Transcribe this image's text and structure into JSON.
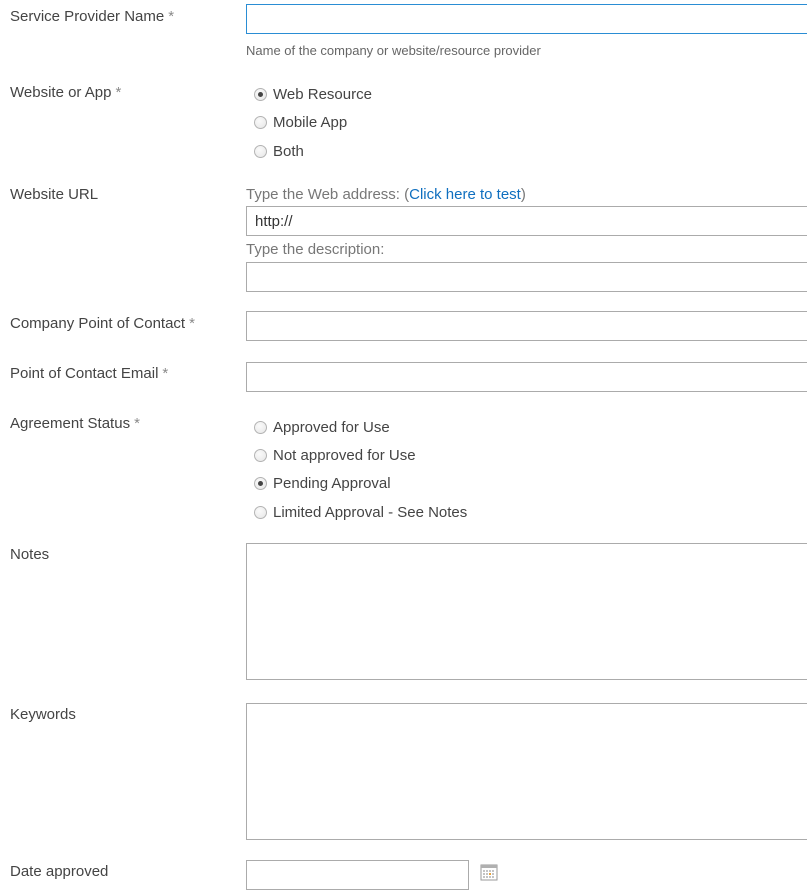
{
  "form": {
    "service_provider": {
      "label": "Service Provider Name",
      "required_mark": "*",
      "value": "",
      "hint": "Name of the company or website/resource provider"
    },
    "website_or_app": {
      "label": "Website or App",
      "required_mark": "*",
      "options": [
        "Web Resource",
        "Mobile App",
        "Both"
      ],
      "selected": "Web Resource"
    },
    "website_url": {
      "label": "Website URL",
      "address_prompt": "Type the Web address: (",
      "test_link": "Click here to test",
      "address_prompt_end": ")",
      "address_value": "http://",
      "description_prompt": "Type the description:",
      "description_value": ""
    },
    "company_contact": {
      "label": "Company Point of Contact",
      "required_mark": "*",
      "value": ""
    },
    "contact_email": {
      "label": "Point of Contact Email",
      "required_mark": "*",
      "value": ""
    },
    "agreement_status": {
      "label": "Agreement Status",
      "required_mark": "*",
      "options": [
        "Approved for Use",
        "Not approved for Use",
        "Pending Approval",
        "Limited Approval - See Notes"
      ],
      "selected": "Pending Approval"
    },
    "notes": {
      "label": "Notes",
      "value": ""
    },
    "keywords": {
      "label": "Keywords",
      "value": ""
    },
    "date_approved": {
      "label": "Date approved",
      "value": "",
      "icon": "calendar-icon"
    }
  },
  "colors": {
    "active_border": "#2a8dd4",
    "link": "#0f6fbf",
    "input_border": "#ababab",
    "label_text": "#444444",
    "required_mark": "#8a8a8a"
  }
}
